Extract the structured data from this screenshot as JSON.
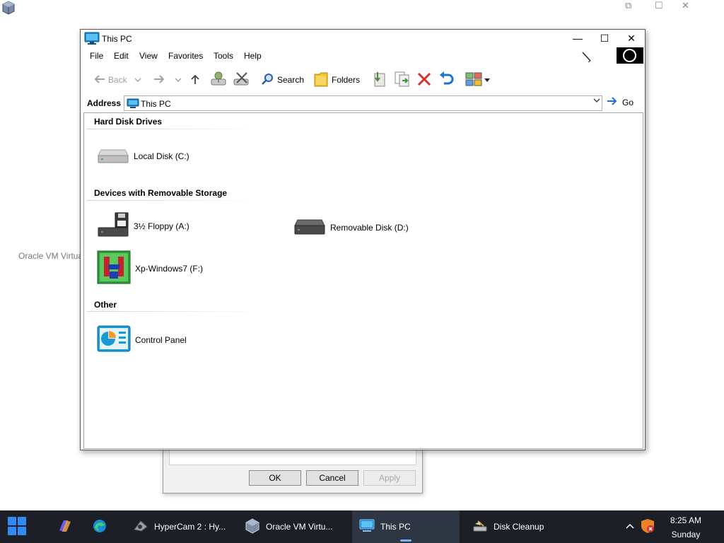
{
  "background_app": {
    "label": "Oracle VM Virtua",
    "controls": {
      "restore": "⧉",
      "maximize": "☐",
      "close": "✕"
    }
  },
  "dialog_behind": {
    "ok_label": "OK",
    "cancel_label": "Cancel",
    "apply_label": "Apply"
  },
  "window": {
    "title": "This PC",
    "controls": {
      "minimize": "—",
      "maximize": "☐",
      "close": "✕"
    },
    "menu": [
      "File",
      "Edit",
      "View",
      "Favorites",
      "Tools",
      "Help"
    ],
    "toolbar": {
      "back_label": "Back",
      "search_label": "Search",
      "folders_label": "Folders"
    },
    "address": {
      "label": "Address",
      "value": "This PC",
      "go_label": "Go"
    },
    "groups": [
      {
        "title": "Hard Disk Drives",
        "items": [
          "Local Disk (C:)"
        ]
      },
      {
        "title": "Devices with Removable Storage",
        "items": [
          "3½ Floppy (A:)",
          "Removable Disk (D:)",
          "Xp-Windows7 (F:)"
        ]
      },
      {
        "title": "Other",
        "items": [
          "Control Panel"
        ]
      }
    ]
  },
  "taskbar": {
    "buttons": [
      {
        "label": "HyperCam 2 : Hy..."
      },
      {
        "label": "Oracle VM Virtu..."
      },
      {
        "label": "This PC"
      },
      {
        "label": "Disk Cleanup"
      }
    ],
    "time": "8:25 AM",
    "day": "Sunday"
  },
  "colors": {
    "taskbar_bg": "#1c2026",
    "accent": "#1a73d9",
    "delete_red": "#d32f2f"
  }
}
